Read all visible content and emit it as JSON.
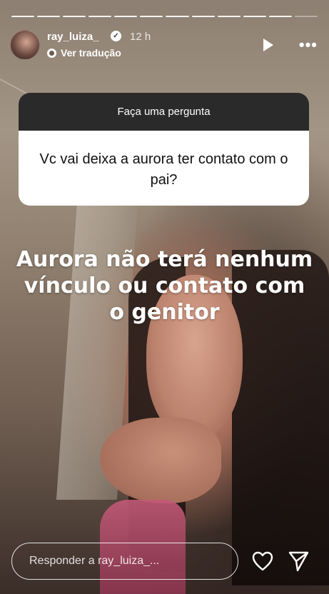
{
  "story": {
    "progress_segments_total": 12,
    "progress_segments_viewed": 11,
    "header": {
      "username": "ray_luiza_",
      "verified": true,
      "time": "12 h",
      "translate_label": "Ver tradução"
    },
    "question_box": {
      "title": "Faça uma pergunta",
      "question": "Vc vai deixa a aurora ter contato com o pai?"
    },
    "overlay_text": "Aurora não terá nenhum vínculo ou contato com o genitor",
    "reply": {
      "placeholder": "Responder a ray_luiza_..."
    },
    "icons": {
      "verified": "verified-badge-icon",
      "translate": "translate-icon",
      "play": "play-icon",
      "more": "more-icon",
      "like": "heart-icon",
      "share": "send-icon"
    }
  }
}
